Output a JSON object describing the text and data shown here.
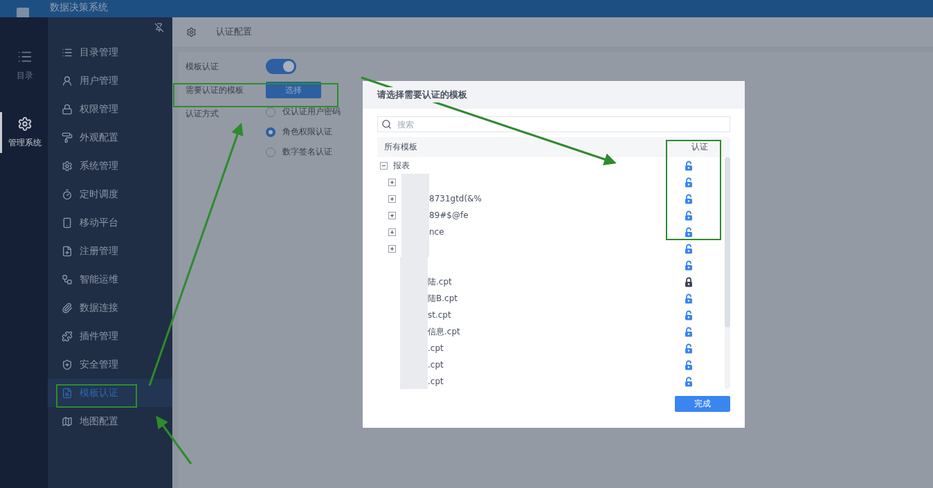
{
  "app": {
    "title": "数据决策系统"
  },
  "rail": [
    {
      "label": "目录",
      "selected": false
    },
    {
      "label": "管理系统",
      "selected": true
    }
  ],
  "menu": [
    {
      "label": "目录管理",
      "selected": false
    },
    {
      "label": "用户管理",
      "selected": false
    },
    {
      "label": "权限管理",
      "selected": false
    },
    {
      "label": "外观配置",
      "selected": false
    },
    {
      "label": "系统管理",
      "selected": false
    },
    {
      "label": "定时调度",
      "selected": false
    },
    {
      "label": "移动平台",
      "selected": false
    },
    {
      "label": "注册管理",
      "selected": false
    },
    {
      "label": "智能运维",
      "selected": false
    },
    {
      "label": "数据连接",
      "selected": false
    },
    {
      "label": "插件管理",
      "selected": false
    },
    {
      "label": "安全管理",
      "selected": false
    },
    {
      "label": "模板认证",
      "selected": true
    },
    {
      "label": "地图配置",
      "selected": false
    }
  ],
  "content": {
    "title": "认证配置",
    "fields": [
      {
        "kind": "toggle",
        "label": "模板认证",
        "on": true
      },
      {
        "kind": "button",
        "label": "需要认证的模板",
        "button": "选择"
      },
      {
        "kind": "radio",
        "label": "认证方式",
        "options": [
          {
            "label": "仅认证用户密码",
            "selected": false
          },
          {
            "label": "角色权限认证",
            "selected": true
          },
          {
            "label": "数字签名认证",
            "selected": false
          }
        ]
      }
    ]
  },
  "dialog": {
    "title": "请选择需要认证的模板",
    "search": {
      "placeholder": "搜索"
    },
    "columns": [
      "所有模板",
      "认证"
    ],
    "tree": [
      {
        "name": "报表",
        "expanded": true,
        "locked": false,
        "children": [
          {
            "kind": "folder",
            "expanded": false,
            "locked": false
          },
          {
            "kind": "folder",
            "name": "8731gtd(&%",
            "expanded": false,
            "locked": false
          },
          {
            "kind": "folder",
            "name": "89#$@fe",
            "expanded": false,
            "locked": false
          },
          {
            "kind": "folder",
            "name": "nce",
            "expanded": false,
            "locked": false
          },
          {
            "kind": "folder",
            "expanded": false,
            "locked": false
          },
          {
            "kind": "file",
            "locked": false
          },
          {
            "kind": "file",
            "name": "陆.cpt",
            "locked": true
          },
          {
            "kind": "file",
            "name": "陆B.cpt",
            "locked": false
          },
          {
            "kind": "file",
            "name": "st.cpt",
            "locked": false
          },
          {
            "kind": "file",
            "name": "信息.cpt",
            "locked": false
          },
          {
            "kind": "file",
            "name": ".cpt",
            "locked": false
          },
          {
            "kind": "file",
            "name": ".cpt",
            "locked": false
          },
          {
            "kind": "file",
            "name": ".cpt",
            "locked": false
          }
        ]
      }
    ],
    "done": "完成"
  }
}
